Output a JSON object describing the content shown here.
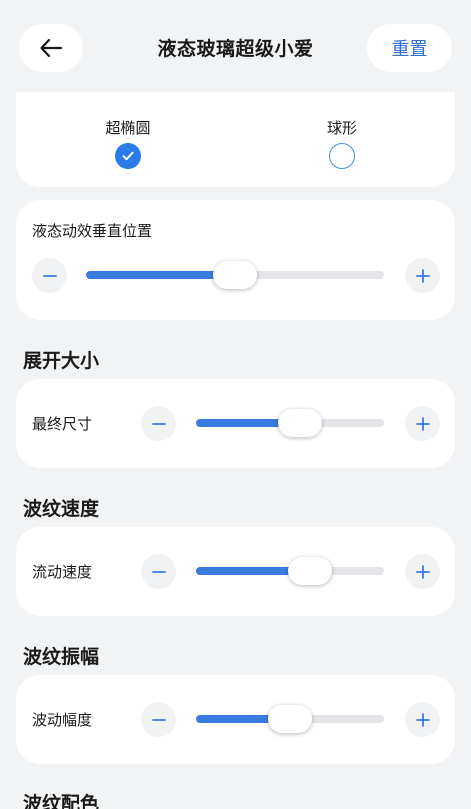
{
  "header": {
    "title": "液态玻璃超级小爱",
    "reset_label": "重置",
    "back_icon": "arrow-left-icon"
  },
  "shape": {
    "options": [
      {
        "label": "超椭圆",
        "selected": true
      },
      {
        "label": "球形",
        "selected": false
      }
    ]
  },
  "vertical_position": {
    "label": "液态动效垂直位置",
    "value": 0.5
  },
  "sections": [
    {
      "title": "展开大小",
      "slider_label": "最终尺寸",
      "value": 0.55
    },
    {
      "title": "波纹速度",
      "slider_label": "流动速度",
      "value": 0.6
    },
    {
      "title": "波纹振幅",
      "slider_label": "波动幅度",
      "value": 0.5
    },
    {
      "title": "波纹配色"
    }
  ],
  "colors": {
    "accent": "#3a7be0",
    "reset_text": "#2f6fd8",
    "background": "#f1f3f5",
    "card": "#ffffff"
  }
}
